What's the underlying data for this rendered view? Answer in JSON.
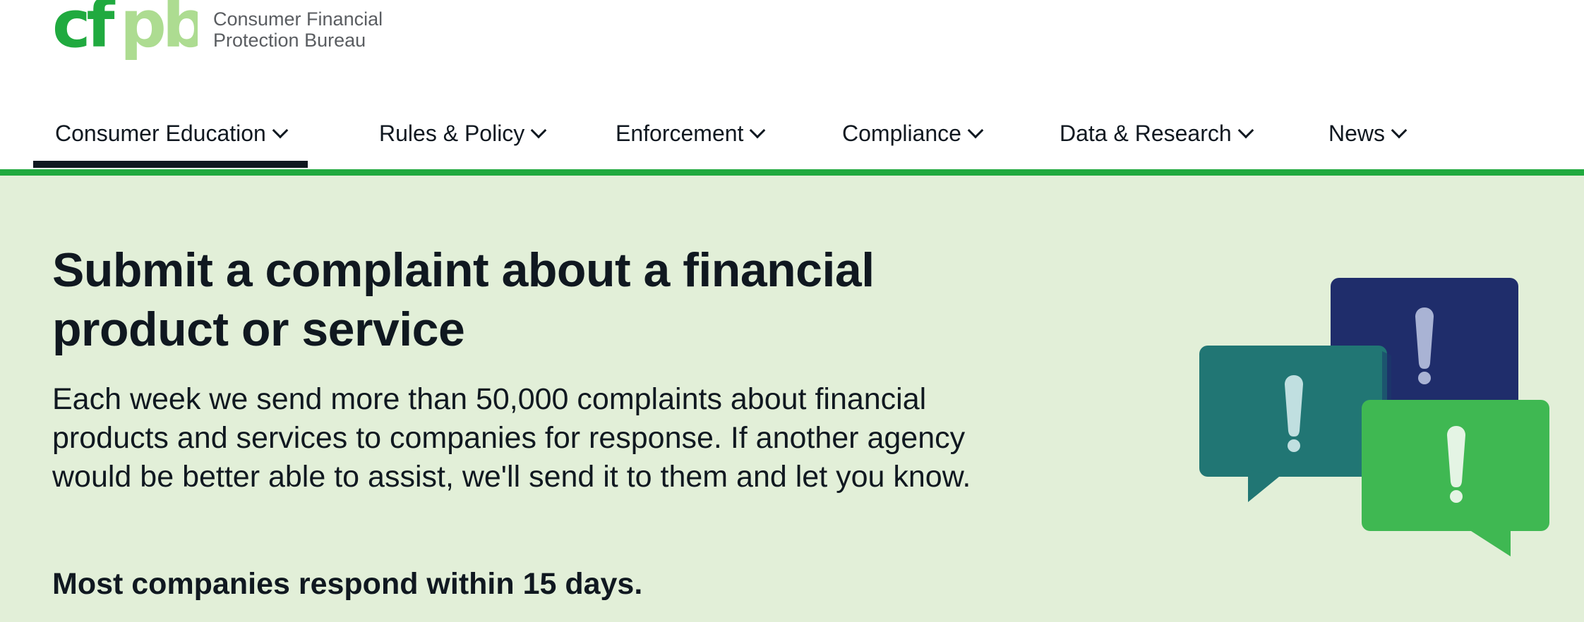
{
  "header": {
    "logo_mark": "cfpb",
    "wordmark_line1": "Consumer Financial",
    "wordmark_line2": "Protection Bureau"
  },
  "nav": {
    "items": [
      {
        "label": "Consumer Education",
        "active": true
      },
      {
        "label": "Rules & Policy"
      },
      {
        "label": "Enforcement"
      },
      {
        "label": "Compliance"
      },
      {
        "label": "Data & Research"
      },
      {
        "label": "News"
      }
    ]
  },
  "hero": {
    "title": "Submit a complaint about a financial product or service",
    "body": "Each week we send more than 50,000 complaints about financial products and services to companies for response. If another agency would be better able to assist, we'll send it to them and let you know.",
    "note": "Most companies respond within 15 days.",
    "illustration_icons": [
      "exclamation-icon",
      "exclamation-icon",
      "exclamation-icon"
    ]
  },
  "colors": {
    "brand_green": "#20aa3f",
    "light_green": "#addc91",
    "hero_bg": "#e2efd8",
    "navy": "#1f2d6b",
    "teal": "#217674",
    "bubble_green": "#3fb852",
    "text": "#101820"
  }
}
